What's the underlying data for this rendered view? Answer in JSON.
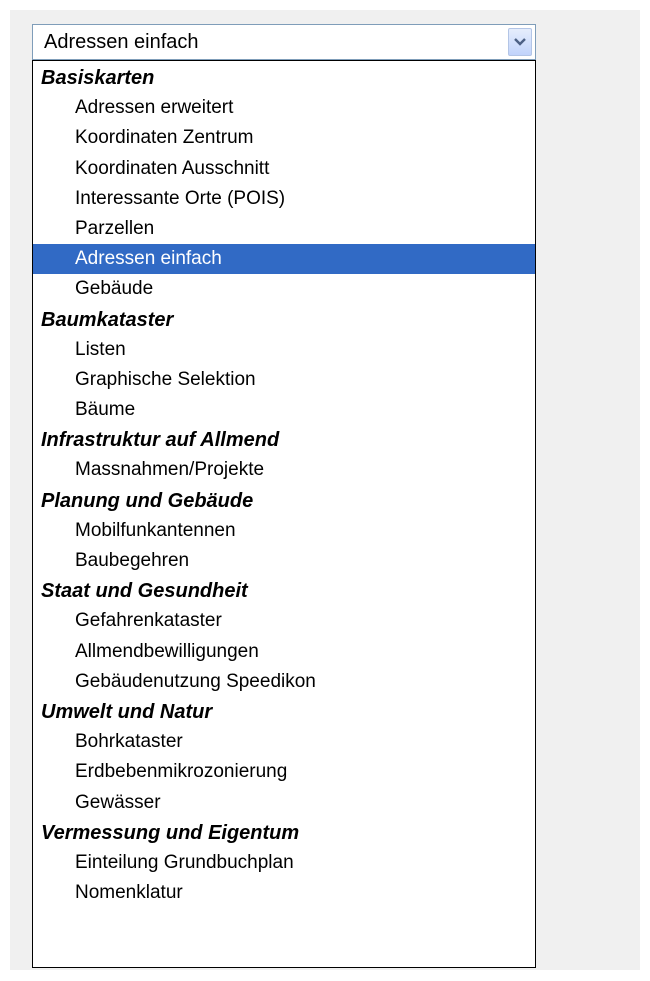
{
  "select": {
    "current_value": "Adressen einfach",
    "button_icon": "chevron-down-icon"
  },
  "colors": {
    "selected_background": "#316ac5",
    "selected_text": "#ffffff",
    "border": "#7f9db9"
  },
  "groups": [
    {
      "label": "Basiskarten",
      "options": [
        "Adressen erweitert",
        "Koordinaten Zentrum",
        "Koordinaten Ausschnitt",
        "Interessante Orte (POIS)",
        "Parzellen",
        "Adressen einfach",
        "Gebäude"
      ]
    },
    {
      "label": "Baumkataster",
      "options": [
        "Listen",
        "Graphische Selektion",
        "Bäume"
      ]
    },
    {
      "label": "Infrastruktur auf Allmend",
      "options": [
        "Massnahmen/Projekte"
      ]
    },
    {
      "label": "Planung und Gebäude",
      "options": [
        "Mobilfunkantennen",
        "Baubegehren"
      ]
    },
    {
      "label": "Staat und Gesundheit",
      "options": [
        "Gefahrenkataster",
        "Allmendbewilligungen",
        "Gebäudenutzung Speedikon"
      ]
    },
    {
      "label": "Umwelt und Natur",
      "options": [
        "Bohrkataster",
        "Erdbebenmikrozonierung",
        "Gewässer"
      ]
    },
    {
      "label": "Vermessung und Eigentum",
      "options": [
        "Einteilung Grundbuchplan",
        "Nomenklatur"
      ]
    }
  ]
}
